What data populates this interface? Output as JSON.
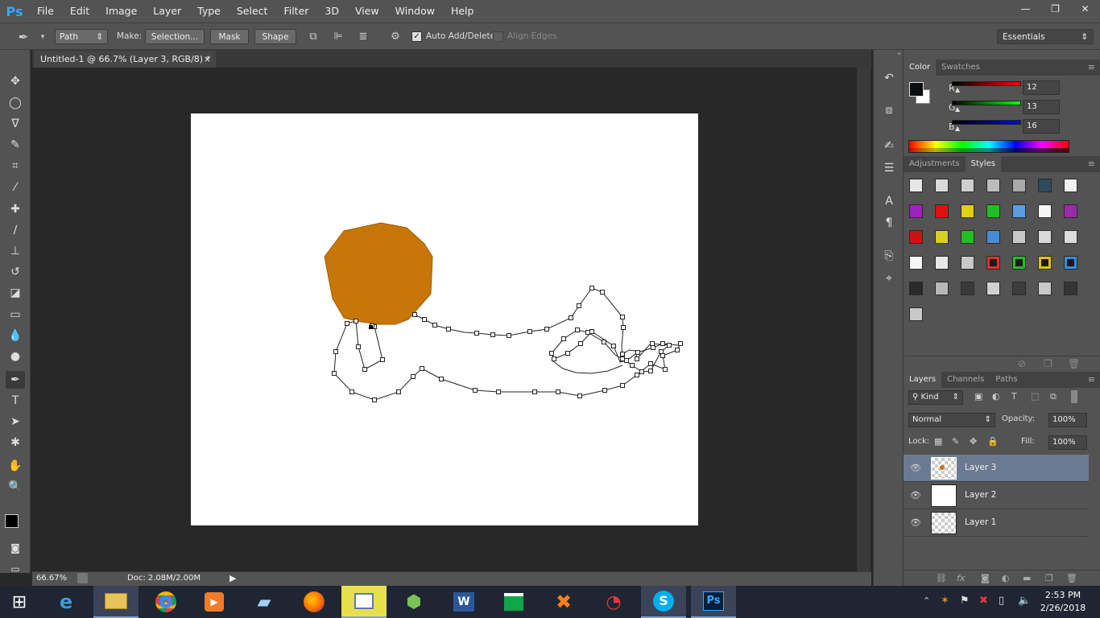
{
  "app": {
    "logo": "Ps"
  },
  "menu": [
    "File",
    "Edit",
    "Image",
    "Layer",
    "Type",
    "Select",
    "Filter",
    "3D",
    "View",
    "Window",
    "Help"
  ],
  "window_controls": [
    "—",
    "❐",
    "✕"
  ],
  "options_bar": {
    "tool_mode": "Path",
    "make_label": "Make:",
    "selection_btn": "Selection...",
    "mask_btn": "Mask",
    "shape_btn": "Shape",
    "auto_add_delete": "Auto Add/Delete",
    "align_edges": "Align Edges",
    "workspace": "Essentials"
  },
  "document": {
    "tab_title": "Untitled-1 @ 66.7% (Layer 3, RGB/8) *",
    "close": "×",
    "fill_color": "#c87608"
  },
  "status": {
    "zoom": "66.67%",
    "doc": "Doc: 2.08M/2.00M"
  },
  "color_panel": {
    "tabs": [
      "Color",
      "Swatches"
    ],
    "r_label": "R",
    "r_value": "12",
    "g_label": "G",
    "g_value": "13",
    "b_label": "B",
    "b_value": "16"
  },
  "styles_panel": {
    "tabs": [
      "Adjustments",
      "Styles"
    ]
  },
  "layers_panel": {
    "tabs": [
      "Layers",
      "Channels",
      "Paths"
    ],
    "kind": "Kind",
    "blend_mode": "Normal",
    "opacity_label": "Opacity:",
    "opacity_value": "100%",
    "lock_label": "Lock:",
    "fill_label": "Fill:",
    "fill_value": "100%",
    "layers": [
      "Layer 3",
      "Layer 2",
      "Layer 1"
    ]
  },
  "taskbar": {
    "time": "2:53 PM",
    "date": "2/26/2018",
    "tray_icons": [
      "chevron-up-icon",
      "network-icon",
      "flag-icon",
      "battery-icon",
      "volume-icon"
    ]
  }
}
